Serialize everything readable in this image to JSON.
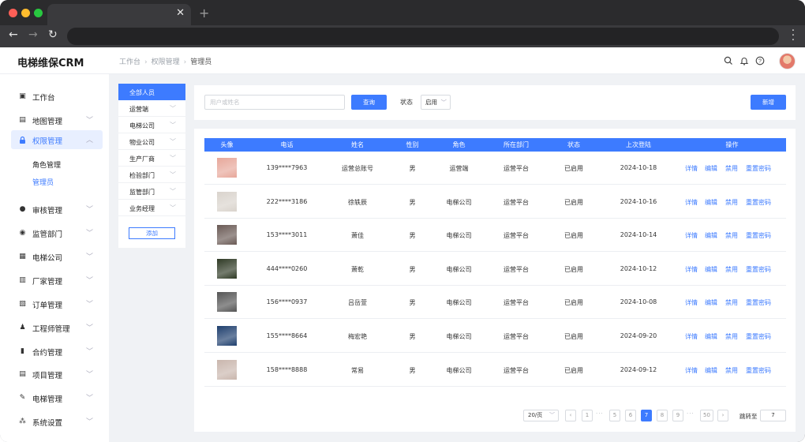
{
  "app": {
    "name": "电梯维保CRM"
  },
  "breadcrumb": [
    "工作台",
    "权限管理",
    "管理员"
  ],
  "sidebar": {
    "items": [
      {
        "label": "工作台",
        "icon": "dashboard-icon"
      },
      {
        "label": "地图管理",
        "icon": "map-icon"
      },
      {
        "label": "权限管理",
        "icon": "lock-icon"
      },
      {
        "label": "审核管理",
        "icon": "user-icon"
      },
      {
        "label": "监管部门",
        "icon": "location-icon"
      },
      {
        "label": "电梯公司",
        "icon": "company-icon"
      },
      {
        "label": "厂家管理",
        "icon": "factory-icon"
      },
      {
        "label": "订单管理",
        "icon": "order-icon"
      },
      {
        "label": "工程师管理",
        "icon": "engineer-icon"
      },
      {
        "label": "合约管理",
        "icon": "contract-icon"
      },
      {
        "label": "项目管理",
        "icon": "project-icon"
      },
      {
        "label": "电梯管理",
        "icon": "wrench-icon"
      },
      {
        "label": "系统设置",
        "icon": "settings-icon"
      }
    ],
    "subitems": [
      "角色管理",
      "管理员"
    ]
  },
  "departments": {
    "items": [
      "全部人员",
      "运营端",
      "电梯公司",
      "物业公司",
      "生产厂商",
      "检验部门",
      "监管部门",
      "业务经理"
    ],
    "add_label": "添加"
  },
  "search": {
    "placeholder": "用户或姓名",
    "query_label": "查询",
    "status_label": "状态",
    "status_value": "启用",
    "new_label": "新增"
  },
  "table": {
    "headers": [
      "头像",
      "电话",
      "姓名",
      "性别",
      "角色",
      "所在部门",
      "状态",
      "上次登陆",
      "操作"
    ],
    "actions": [
      "详情",
      "编辑",
      "禁用",
      "重置密码"
    ],
    "rows": [
      {
        "phone": "139****7963",
        "name": "运营总账号",
        "gender": "男",
        "role": "运营端",
        "dept": "运营平台",
        "status": "已启用",
        "last_login": "2024-10-18",
        "avatar_color": "#e7a79a"
      },
      {
        "phone": "222****3186",
        "name": "徐轶辰",
        "gender": "男",
        "role": "电梯公司",
        "dept": "运营平台",
        "status": "已启用",
        "last_login": "2024-10-16",
        "avatar_color": "#d9d3cc"
      },
      {
        "phone": "153****3011",
        "name": "萧佳",
        "gender": "男",
        "role": "电梯公司",
        "dept": "运营平台",
        "status": "已启用",
        "last_login": "2024-10-14",
        "avatar_color": "#6a5a55"
      },
      {
        "phone": "444****0260",
        "name": "萧乾",
        "gender": "男",
        "role": "电梯公司",
        "dept": "运营平台",
        "status": "已启用",
        "last_login": "2024-10-12",
        "avatar_color": "#2f3a25"
      },
      {
        "phone": "156****0937",
        "name": "吕岳萱",
        "gender": "男",
        "role": "电梯公司",
        "dept": "运营平台",
        "status": "已启用",
        "last_login": "2024-10-08",
        "avatar_color": "#555555"
      },
      {
        "phone": "155****8664",
        "name": "梅宏艳",
        "gender": "男",
        "role": "电梯公司",
        "dept": "运营平台",
        "status": "已启用",
        "last_login": "2024-09-20",
        "avatar_color": "#1f3f6e"
      },
      {
        "phone": "158****8888",
        "name": "常易",
        "gender": "男",
        "role": "电梯公司",
        "dept": "运营平台",
        "status": "已启用",
        "last_login": "2024-09-12",
        "avatar_color": "#c9b6ad"
      }
    ]
  },
  "pagination": {
    "page_size": "20/页",
    "pages": [
      "1",
      "5",
      "6",
      "7",
      "8",
      "9",
      "50"
    ],
    "current": "7",
    "jump_label": "跳转至",
    "jump_value": "7"
  },
  "colors": {
    "accent": "#3d7bff",
    "active_bg": "#e8efff"
  }
}
